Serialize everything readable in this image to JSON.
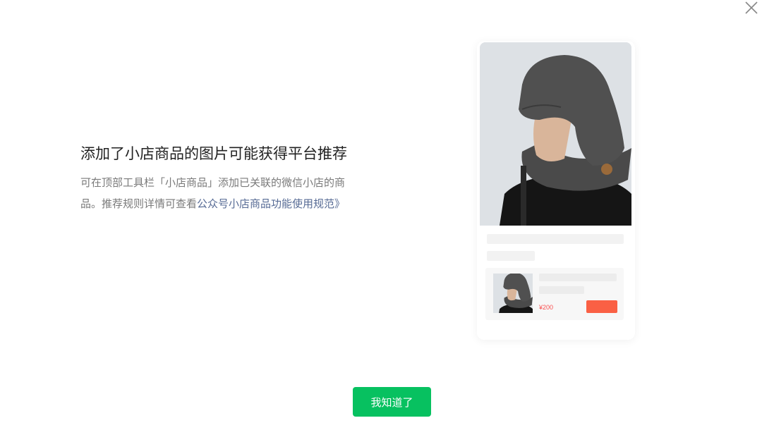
{
  "dialog": {
    "title": "添加了小店商品的图片可能获得平台推荐",
    "desc_prefix": "可在顶部工具栏「小店商品」添加已关联的微信小店的商品。推荐规则详情可查看",
    "link_text": "公众号小店商品功能使用规范》",
    "confirm_label": "我知道了"
  },
  "preview": {
    "price": "¥200"
  },
  "colors": {
    "primary_button": "#07c160",
    "link": "#576b95",
    "price": "#fa5151",
    "buy_button": "#fa6044"
  },
  "icons": {
    "close": "close-icon"
  }
}
